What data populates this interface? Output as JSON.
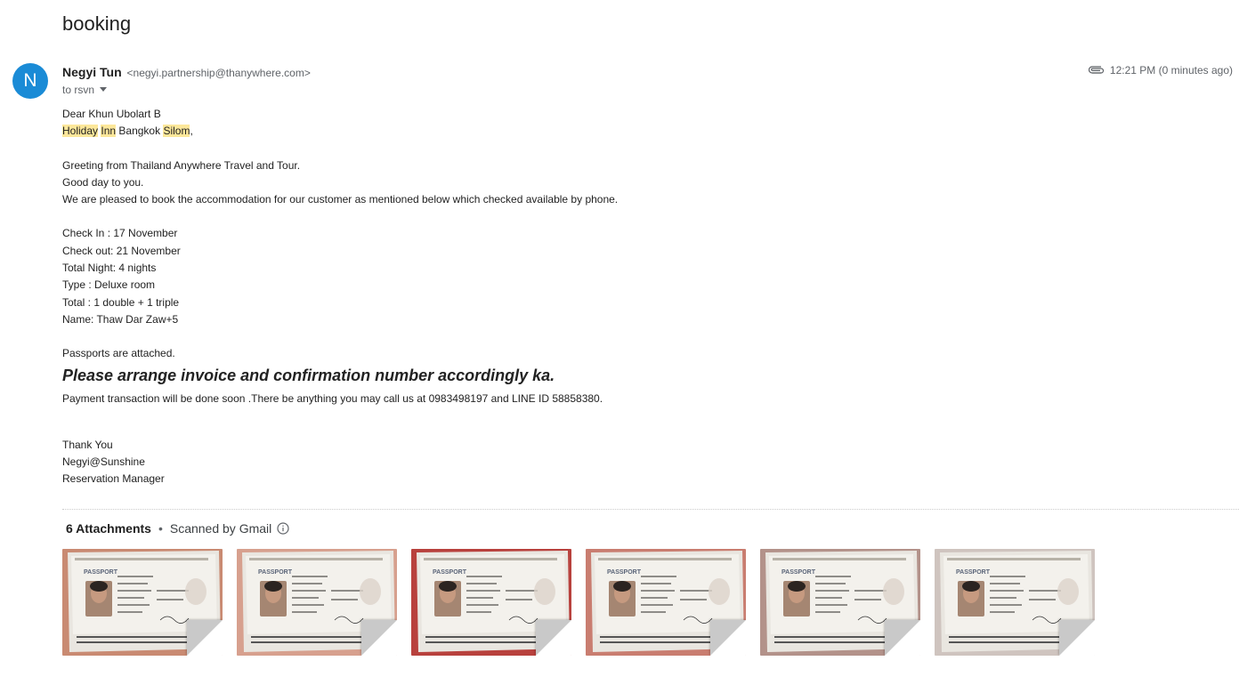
{
  "subject": "booking",
  "sender": {
    "avatar_letter": "N",
    "name": "Negyi Tun",
    "email": "<negyi.partnership@thanywhere.com>",
    "to": "to rsvn",
    "time": "12:21 PM (0 minutes ago)"
  },
  "icons": {
    "attachment": "paperclip-icon",
    "info": "info-circle-icon",
    "dropdown": "chevron-down-icon"
  },
  "colors": {
    "avatar": "#1a8bd6",
    "highlight": "#fce79a"
  },
  "body": {
    "greeting": "Dear Khun Ubolart B",
    "hotel_holiday": "Holiday",
    "hotel_inn": "Inn",
    "hotel_bangkok": " Bangkok ",
    "hotel_silom": "Silom",
    "hotel_comma": ",",
    "line_greeting": "Greeting from Thailand Anywhere Travel and Tour.",
    "line_goodday": "Good day to you.",
    "line_request": "We are pleased to book the accommodation for our customer as mentioned below which checked available by phone.",
    "check_in": "Check In : 17 November",
    "check_out": "Check out: 21 November",
    "total_night": "Total Night: 4 nights",
    "type": "Type : Deluxe room",
    "total": "Total : 1 double + 1 triple",
    "name": "Name: Thaw Dar Zaw+5",
    "passports": "Passports are attached.",
    "emphasis": "Please arrange invoice and confirmation number accordingly ka.",
    "payment": "Payment transaction will be done soon .There be anything you may call us at 0983498197 and LINE ID 58858380.",
    "thanks": "Thank You",
    "signature": "Negyi@Sunshine",
    "role": "Reservation Manager"
  },
  "attachments": {
    "count_label": "6 Attachments",
    "separator": "•",
    "scanned": "Scanned by Gmail",
    "items": [
      {
        "label": "PASSPORT",
        "bg": "#c98a72"
      },
      {
        "label": "PASSPORT",
        "bg": "#d7a08e"
      },
      {
        "label": "PASSPORT",
        "bg": "#b8413d"
      },
      {
        "label": "PASSPORT",
        "bg": "#c97d70"
      },
      {
        "label": "PASSPORT",
        "bg": "#b3928a"
      },
      {
        "label": "PASSPORT",
        "bg": "#cfc4bf"
      }
    ]
  }
}
